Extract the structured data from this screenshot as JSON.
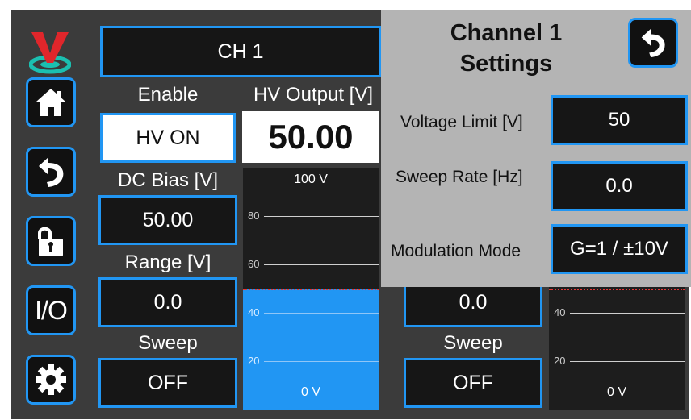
{
  "colors": {
    "accent": "#2196f3",
    "panel": "#3b3b3b",
    "popup": "#b4b4b4",
    "limit_line": "#e53935"
  },
  "sidebar": {
    "logo": "logo-v-icon",
    "buttons": [
      {
        "icon": "home-icon"
      },
      {
        "icon": "back-arrow-icon"
      },
      {
        "icon": "unlock-icon"
      },
      {
        "label": "I/O"
      },
      {
        "icon": "gear-icon"
      }
    ]
  },
  "channel1": {
    "header": "CH 1",
    "enable_label": "Enable",
    "enable_value": "HV ON",
    "hv_output_label": "HV Output [V]",
    "hv_output_value": "50.00",
    "dc_bias_label": "DC Bias [V]",
    "dc_bias_value": "50.00",
    "range_label": "Range [V]",
    "range_value": "0.0",
    "sweep_label": "Sweep",
    "sweep_value": "OFF",
    "gauge": {
      "top_label": "100 V",
      "bottom_label": "0 V",
      "ticks": [
        "80",
        "60",
        "40",
        "20"
      ],
      "level_fraction": 0.5,
      "limit_fraction": 0.5
    }
  },
  "channel2": {
    "range_value": "0.0",
    "sweep_label": "Sweep",
    "sweep_value": "OFF",
    "gauge": {
      "bottom_label": "0 V",
      "ticks": [
        "40",
        "20"
      ],
      "level_fraction": 0.0,
      "limit_fraction": 0.5
    }
  },
  "settings_popup": {
    "title": "Channel 1 Settings",
    "back_icon": "back-arrow-icon",
    "voltage_limit_label": "Voltage Limit [V]",
    "voltage_limit_value": "50",
    "sweep_rate_label": "Sweep Rate [Hz]",
    "sweep_rate_value": "0.0",
    "modulation_label": "Modulation Mode",
    "modulation_value": "G=1 / ±10V"
  }
}
